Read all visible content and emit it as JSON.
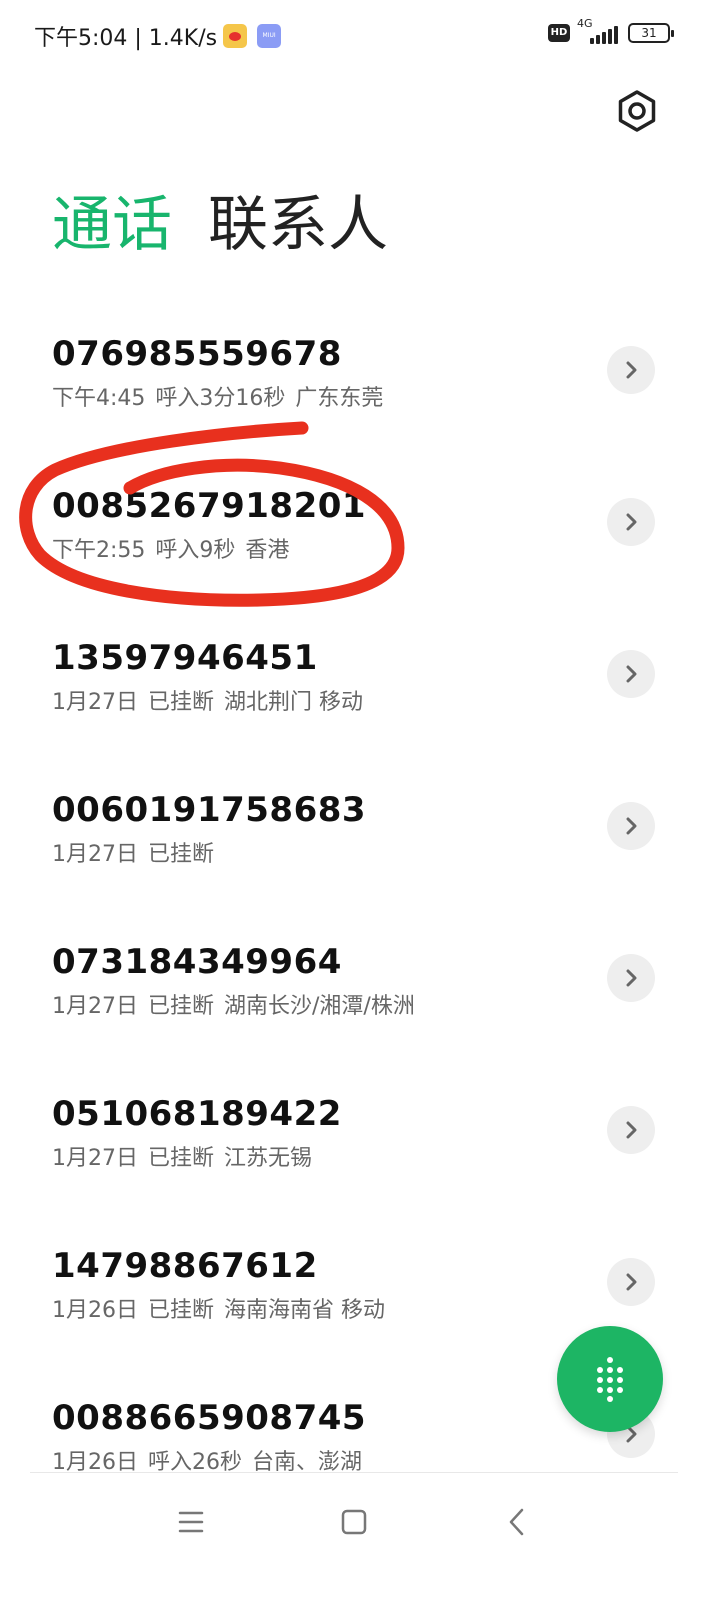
{
  "status_bar": {
    "time_and_speed": "下午5:04 | 1.4K/s",
    "miui_badge": "MIUI",
    "hd_badge": "HD",
    "network_type": "4G",
    "battery_level": "31"
  },
  "header": {
    "tabs": [
      {
        "label": "通话",
        "active": true
      },
      {
        "label": "联系人",
        "active": false
      }
    ],
    "settings_icon": "gear-icon"
  },
  "call_log": [
    {
      "number": "076985559678",
      "time": "下午4:45",
      "status": "呼入3分16秒",
      "location": "广东东莞"
    },
    {
      "number": "0085267918201",
      "time": "下午2:55",
      "status": "呼入9秒",
      "location": "香港"
    },
    {
      "number": "13597946451",
      "time": "1月27日",
      "status": "已挂断",
      "location": "湖北荆门 移动"
    },
    {
      "number": "0060191758683",
      "time": "1月27日",
      "status": "已挂断",
      "location": ""
    },
    {
      "number": "073184349964",
      "time": "1月27日",
      "status": "已挂断",
      "location": "湖南长沙/湘潭/株洲"
    },
    {
      "number": "051068189422",
      "time": "1月27日",
      "status": "已挂断",
      "location": "江苏无锡"
    },
    {
      "number": "14798867612",
      "time": "1月26日",
      "status": "已挂断",
      "location": "海南海南省 移动"
    },
    {
      "number": "0088665908745",
      "time": "1月26日",
      "status": "呼入26秒",
      "location": "台南、澎湖"
    }
  ],
  "colors": {
    "accent_green": "#18b56d",
    "fab_green": "#1db564",
    "annotation_red": "#e8301e"
  },
  "icons": {
    "chevron": "chevron-right-icon",
    "dialpad": "dialpad-icon",
    "nav": [
      "menu-icon",
      "home-icon",
      "back-icon"
    ]
  }
}
